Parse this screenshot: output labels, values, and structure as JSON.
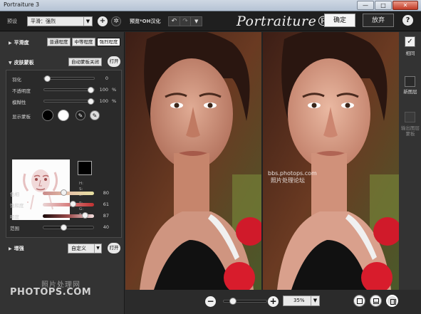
{
  "window": {
    "title": "Portraiture 3",
    "min_label": "—",
    "max_label": "□",
    "close_label": "✕"
  },
  "toolbar": {
    "preset_label": "预设",
    "preset_value": "平滑：强烈",
    "add_icon": "plus-icon",
    "settings_icon": "gear-icon",
    "preview_label": "预览*OH汉化",
    "undo_icon": "undo-icon",
    "redo_icon": "redo-icon",
    "history_icon": "dropdown-icon",
    "brand": "Portraiture® 3",
    "ok_label": "确定",
    "cancel_label": "放弃",
    "help_label": "?"
  },
  "smoothing": {
    "title": "平滑度",
    "buttons": [
      "普通程度",
      "中等程度",
      "强烈程度"
    ],
    "active_index": 2
  },
  "skin_mask": {
    "title": "皮肤蒙板",
    "auto_mask_label": "自动蒙板关闭",
    "open_label": "打开",
    "sliders": [
      {
        "label": "羽化",
        "value": "0",
        "fraction": 0.0,
        "unit": ""
      },
      {
        "label": "不透明度",
        "value": "100",
        "fraction": 1.0,
        "unit": "%"
      },
      {
        "label": "模糊性",
        "value": "100",
        "fraction": 1.0,
        "unit": "%"
      }
    ],
    "show_mask_label": "显示蒙板",
    "hsl_labels": [
      "H:",
      "S:",
      "L:",
      "R:",
      "G:",
      "B:"
    ],
    "color_sliders": [
      {
        "label": "色相",
        "value": "80",
        "fraction": 0.4
      },
      {
        "label": "饱和度",
        "value": "61",
        "fraction": 0.61
      },
      {
        "label": "明度",
        "value": "87",
        "fraction": 0.87
      },
      {
        "label": "范围",
        "value": "40",
        "fraction": 0.4
      }
    ]
  },
  "enhance": {
    "title": "增强",
    "select_value": "自定义",
    "open_label": "打开"
  },
  "watermarks": {
    "line1": "照片处理网",
    "line2": "PHOTOPS.COM",
    "preview_line1": "bbs.photops.com",
    "preview_line2": "照片处理论坛"
  },
  "bottom": {
    "zoom_out": "−",
    "zoom_in": "+",
    "zoom_fraction": 0.15,
    "zoom_value": "35%"
  },
  "right_panel": {
    "items": [
      {
        "label": "相同",
        "checked": true
      },
      {
        "label": "新图层",
        "checked": false
      },
      {
        "label": "输出图层蒙板",
        "checked": false
      }
    ]
  },
  "colors": {
    "accent": "#f0f0f0",
    "panel": "#333333",
    "toolbar": "#1f1f1f"
  }
}
